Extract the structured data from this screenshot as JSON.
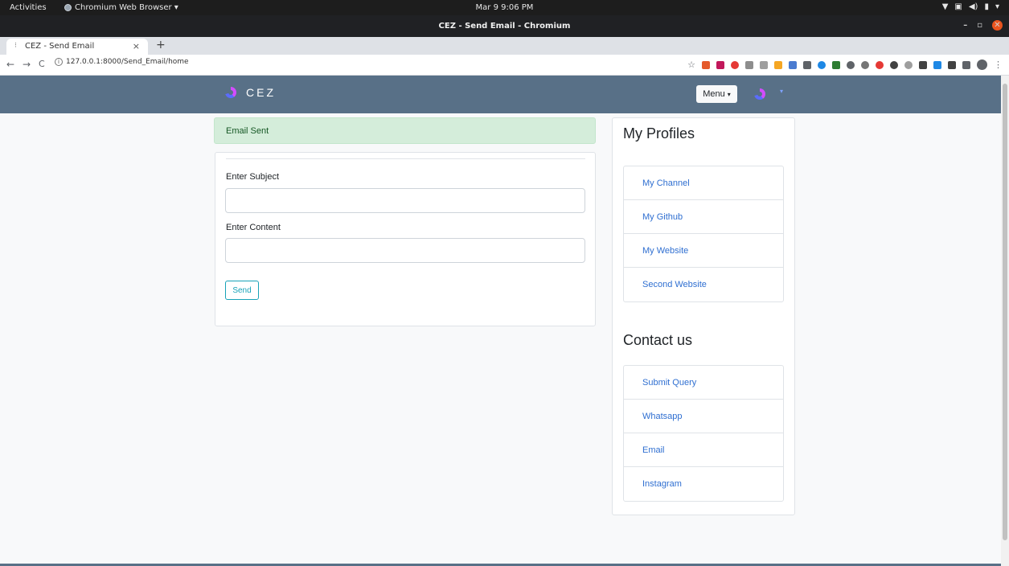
{
  "os": {
    "activities": "Activities",
    "app_name": "Chromium Web Browser ▾",
    "clock": "Mar 9  9:06 PM",
    "tray": [
      "▼",
      "▣",
      "◀)",
      "▮",
      "▾"
    ]
  },
  "window": {
    "title": "CEZ - Send Email - Chromium",
    "controls": {
      "minimize": "–",
      "maximize": "▫",
      "close": "✕"
    }
  },
  "tabs": [
    {
      "title": "CEZ - Send Email",
      "favicon": "⁝",
      "close": "×"
    }
  ],
  "new_tab": "+",
  "address_bar": {
    "back": "←",
    "forward": "→",
    "reload": "C",
    "info": "i",
    "url": "127.0.0.1:8000/Send_Email/home"
  },
  "extensions": [
    {
      "name": "star-icon",
      "glyph": "☆"
    },
    {
      "name": "ext-1",
      "color": "#e55a2b"
    },
    {
      "name": "ext-2",
      "color": "#c2185b"
    },
    {
      "name": "ext-3",
      "color": "#e53935",
      "round": true
    },
    {
      "name": "ext-4",
      "color": "#8d8d8d"
    },
    {
      "name": "ext-5",
      "color": "#9e9e9e"
    },
    {
      "name": "ext-6",
      "color": "#f5a623"
    },
    {
      "name": "ext-7",
      "color": "#4a7bd0"
    },
    {
      "name": "ext-8",
      "color": "#5f6368"
    },
    {
      "name": "ext-9",
      "color": "#1e88e5",
      "round": true
    },
    {
      "name": "ext-10",
      "color": "#2e7d32"
    },
    {
      "name": "ext-11",
      "color": "#5f6368",
      "round": true
    },
    {
      "name": "ext-12",
      "color": "#757575",
      "round": true
    },
    {
      "name": "ext-13",
      "color": "#e53935",
      "round": true
    },
    {
      "name": "ext-14",
      "color": "#424242",
      "round": true
    },
    {
      "name": "ext-15",
      "color": "#9e9e9e",
      "round": true
    },
    {
      "name": "ext-16",
      "color": "#424242"
    },
    {
      "name": "ext-17",
      "color": "#1e88e5"
    },
    {
      "name": "ext-18",
      "color": "#424242"
    },
    {
      "name": "ext-19",
      "color": "#5f6368"
    }
  ],
  "kebab": "⋮",
  "navbar": {
    "brand": "CEZ",
    "menu_label": "Menu",
    "menu_caret": "▾",
    "dropdown_caret": "▾",
    "background": "#587087"
  },
  "alert": {
    "text": "Email Sent"
  },
  "form": {
    "subject_label": "Enter Subject",
    "subject_value": "",
    "content_label": "Enter Content",
    "content_value": "",
    "send_label": "Send"
  },
  "sidebar": {
    "profiles_heading": "My Profiles",
    "profiles": [
      "My Channel",
      "My Github",
      "My Website",
      "Second Website"
    ],
    "contact_heading": "Contact us",
    "contacts": [
      "Submit Query",
      "Whatsapp",
      "Email",
      "Instagram"
    ]
  }
}
